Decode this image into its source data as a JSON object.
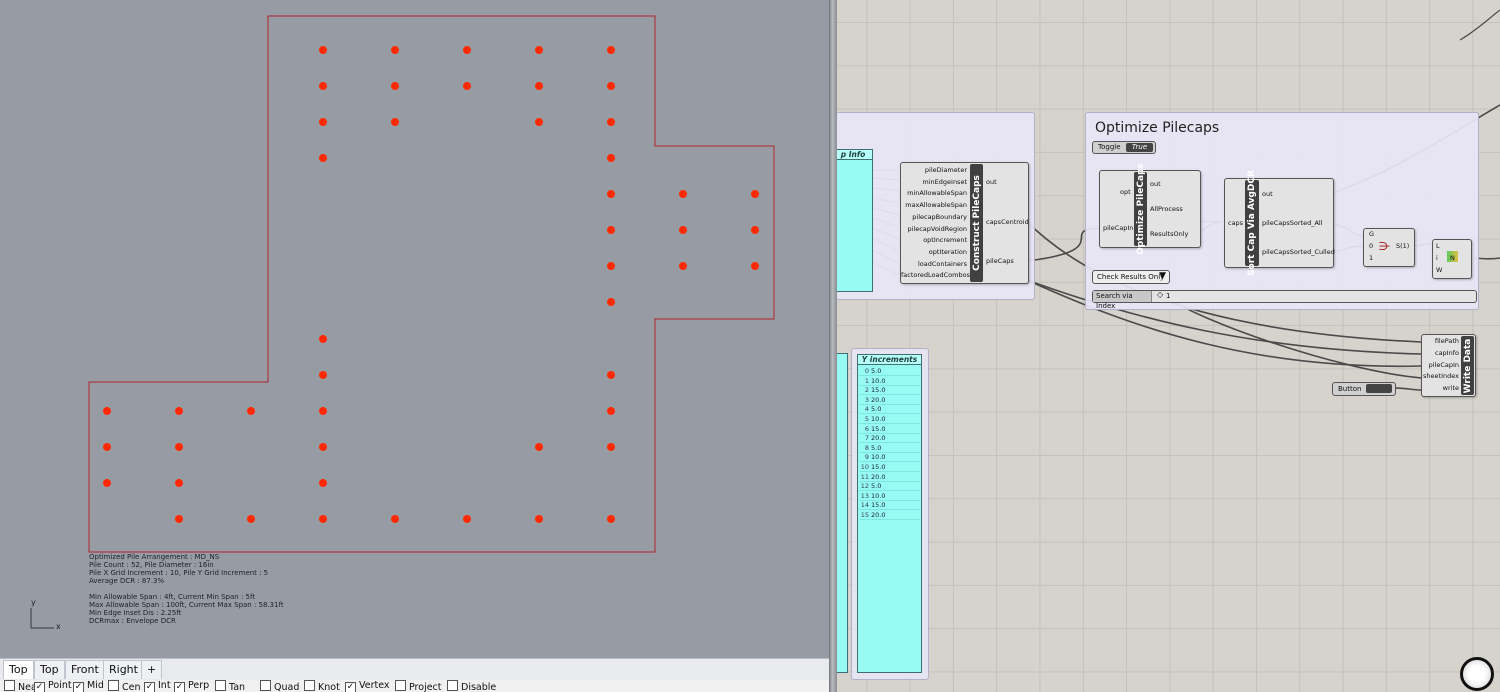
{
  "viewport": {
    "info_lines": [
      "Optimized Pile Arrangement : MD_NS",
      "Pile Count : 52, Pile Diameter : 16in",
      "Pile X Grid Increment : 10, Pile Y Grid Increment : 5",
      "Average DCR : 87.3%",
      "",
      "Min Allowable Span : 4ft, Current Min Span : 5ft",
      "Max Allowable Span : 100ft, Current Max Span : 58.31ft",
      "Min Edge Inset Dis : 2.25ft",
      "DCRmax : Envelope DCR"
    ],
    "axis_y": "y",
    "axis_x": "x",
    "tabs": [
      "Top",
      "Top",
      "Front",
      "Right",
      "+"
    ],
    "active_tab": 0,
    "snaps": [
      {
        "label": "Near",
        "checked": false
      },
      {
        "label": "Point",
        "checked": true
      },
      {
        "label": "Mid",
        "checked": true
      },
      {
        "label": "Cen",
        "checked": false
      },
      {
        "label": "Int",
        "checked": true
      },
      {
        "label": "Perp",
        "checked": true
      },
      {
        "label": "Tan",
        "checked": false
      },
      {
        "label": "Quad",
        "checked": false
      },
      {
        "label": "Knot",
        "checked": false
      },
      {
        "label": "Vertex",
        "checked": true
      },
      {
        "label": "Project",
        "checked": false
      },
      {
        "label": "Disable",
        "checked": false
      }
    ],
    "colors": {
      "boundary": "#b0252a",
      "pile": "#ff2a00",
      "background": "#979ca4"
    }
  },
  "canvas": {
    "group_title": "Optimize Pilecaps",
    "info_panel_title": "p Info",
    "construct": {
      "title": "Construct PileCaps",
      "inputs": [
        "pileDiameter",
        "minEdgeInset",
        "minAllowableSpan",
        "maxAllowableSpan",
        "pilecapBoundary",
        "pilecapVoidRegion",
        "optIncrement",
        "optIteration",
        "loadContainers",
        "factoredLoadCombos"
      ],
      "outputs": [
        "out",
        "capsCentroid",
        "pileCaps"
      ]
    },
    "toggle": {
      "label": "Toggle",
      "value": "True"
    },
    "optimize": {
      "title": "Optimize PileCaps",
      "inputs": [
        "opt",
        "pileCapIn"
      ],
      "outputs": [
        "out",
        "AllProcess",
        "ResultsOnly"
      ]
    },
    "sort": {
      "title": "Sort Cap Via AvgDCR",
      "inputs": [
        "caps"
      ],
      "outputs": [
        "out",
        "pileCapsSorted_All",
        "pileCapsSorted_Culled"
      ]
    },
    "gate": {
      "inputs": [
        "G",
        "0",
        "1"
      ],
      "output": "S(1)"
    },
    "list": {
      "inputs": [
        "L",
        "i",
        "W"
      ],
      "value": "N"
    },
    "check_results": "Check Results Only",
    "search": {
      "label": "Search via Index",
      "value": "1"
    },
    "write": {
      "title": "Write Data",
      "inputs": [
        "filePath",
        "capInfo",
        "pileCapIn",
        "sheetIndex",
        "write"
      ]
    },
    "button": "Button",
    "y_panel": {
      "title": "Y increments",
      "rows": [
        "5.0",
        "10.0",
        "15.0",
        "20.0",
        "5.0",
        "10.0",
        "15.0",
        "20.0",
        "5.0",
        "10.0",
        "15.0",
        "20.0",
        "5.0",
        "10.0",
        "15.0",
        "20.0"
      ]
    }
  }
}
